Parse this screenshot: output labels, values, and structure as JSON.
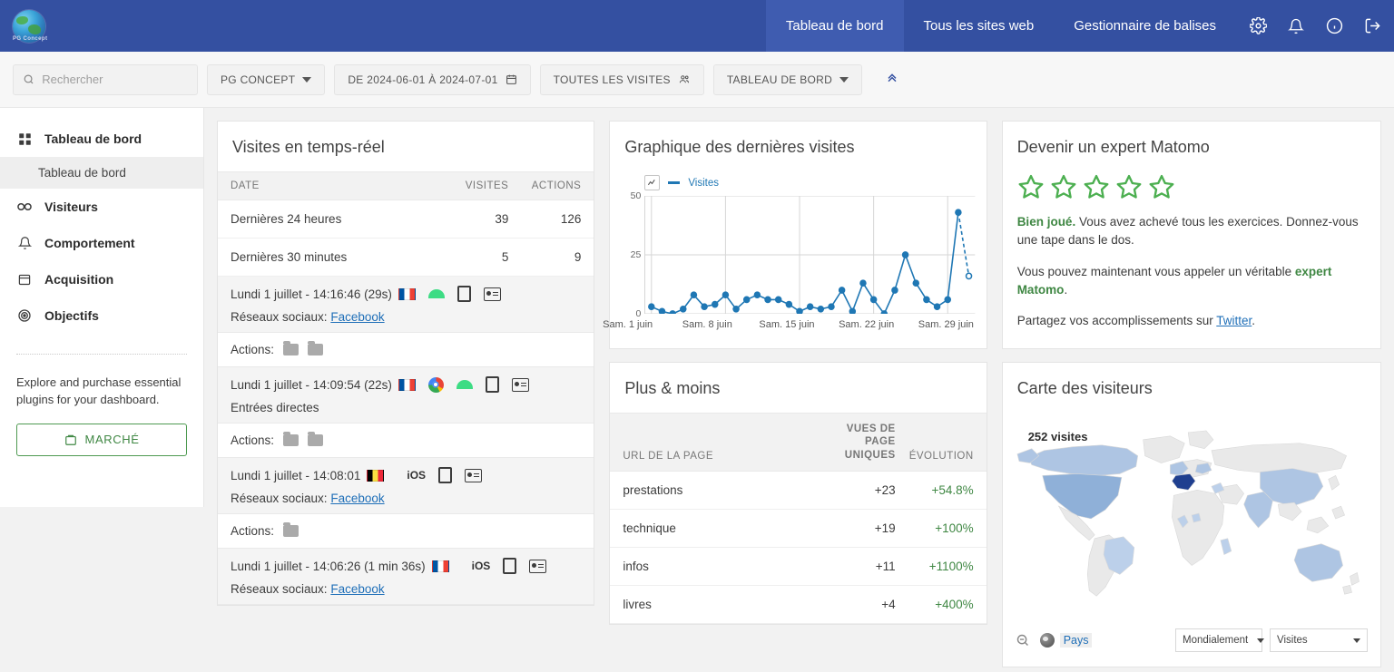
{
  "header": {
    "logo_caption": "PG Concept",
    "nav": [
      {
        "label": "Tableau de bord",
        "active": true
      },
      {
        "label": "Tous les sites web",
        "active": false
      },
      {
        "label": "Gestionnaire de balises",
        "active": false
      }
    ],
    "icons": [
      "gear-icon",
      "bell-icon",
      "info-icon",
      "logout-icon"
    ],
    "brand_color": "#3450a1"
  },
  "filterbar": {
    "search_placeholder": "Rechercher",
    "site_selector": "PG CONCEPT",
    "date_range": "DE 2024-06-01 À 2024-07-01",
    "segment": "TOUTES LES VISITES",
    "dashboard_selector": "TABLEAU DE BORD"
  },
  "sidebar": {
    "items": [
      {
        "label": "Tableau de bord",
        "icon": "grid-icon"
      },
      {
        "label": "Visiteurs",
        "icon": "visitors-icon"
      },
      {
        "label": "Comportement",
        "icon": "bell-icon"
      },
      {
        "label": "Acquisition",
        "icon": "archive-icon"
      },
      {
        "label": "Objectifs",
        "icon": "target-icon"
      }
    ],
    "sub_item": "Tableau de bord",
    "promo_text": "Explore and purchase essential plugins for your dashboard.",
    "market_button": "MARCHÉ"
  },
  "realtime": {
    "title": "Visites en temps-réel",
    "columns": [
      "DATE",
      "VISITES",
      "ACTIONS"
    ],
    "summary": [
      {
        "label": "Dernières 24 heures",
        "visits": "39",
        "actions": "126"
      },
      {
        "label": "Dernières 30 minutes",
        "visits": "5",
        "actions": "9"
      }
    ],
    "actions_label": "Actions:",
    "visits": [
      {
        "time": "Lundi 1 juillet - 14:16:46 (29s)",
        "flag": "fr",
        "browser": null,
        "os": "android",
        "device": "mobile-icon",
        "profile": "visitor-profile-icon",
        "referrer_label": "Réseaux sociaux:",
        "referrer_link": "Facebook",
        "action_count": 2
      },
      {
        "time": "Lundi 1 juillet - 14:09:54 (22s)",
        "flag": "fr",
        "browser": "chrome",
        "os": "android",
        "device": "mobile-icon",
        "profile": "visitor-profile-icon",
        "referrer_label": "Entrées directes",
        "referrer_link": null,
        "action_count": 2
      },
      {
        "time": "Lundi 1 juillet - 14:08:01",
        "flag": "be",
        "browser": null,
        "os": "iOS",
        "device": "mobile-icon",
        "profile": "visitor-profile-icon",
        "referrer_label": "Réseaux sociaux:",
        "referrer_link": "Facebook",
        "action_count": 1
      },
      {
        "time": "Lundi 1 juillet - 14:06:26 (1 min 36s)",
        "flag": "fr",
        "browser": null,
        "os": "iOS",
        "device": "mobile-icon",
        "profile": "visitor-profile-icon",
        "referrer_label": "Réseaux sociaux:",
        "referrer_link": "Facebook",
        "action_count": 0
      }
    ]
  },
  "visits_graph": {
    "title": "Graphique des dernières visites"
  },
  "chart_data": {
    "type": "line",
    "title": "Graphique des dernières visites",
    "xlabel": "",
    "ylabel": "",
    "ylim": [
      0,
      50
    ],
    "yticks": [
      0,
      25,
      50
    ],
    "grid": true,
    "legend": [
      "Visites"
    ],
    "legend_position": "top-left",
    "series_color": "#1f77b4",
    "x_tick_labels": [
      "Sam. 1 juin",
      "Sam. 8 juin",
      "Sam. 15 juin",
      "Sam. 22 juin",
      "Sam. 29 juin"
    ],
    "x_tick_indices": [
      0,
      7,
      14,
      21,
      28
    ],
    "x": [
      "1 juin",
      "2 juin",
      "3 juin",
      "4 juin",
      "5 juin",
      "6 juin",
      "7 juin",
      "8 juin",
      "9 juin",
      "10 juin",
      "11 juin",
      "12 juin",
      "13 juin",
      "14 juin",
      "15 juin",
      "16 juin",
      "17 juin",
      "18 juin",
      "19 juin",
      "20 juin",
      "21 juin",
      "22 juin",
      "23 juin",
      "24 juin",
      "25 juin",
      "26 juin",
      "27 juin",
      "28 juin",
      "29 juin",
      "30 juin",
      "1 juillet"
    ],
    "series": [
      {
        "name": "Visites",
        "values": [
          3,
          1,
          0,
          2,
          8,
          3,
          4,
          8,
          2,
          6,
          8,
          6,
          6,
          4,
          1,
          3,
          2,
          3,
          10,
          1,
          13,
          6,
          0,
          10,
          25,
          13,
          6,
          3,
          6,
          43,
          16
        ]
      }
    ],
    "last_point_dashed": true,
    "last_point_value": 16
  },
  "plus_moins": {
    "title": "Plus & moins",
    "columns": [
      "URL DE LA PAGE",
      "VUES DE PAGE UNIQUES",
      "ÉVOLUTION"
    ],
    "rows": [
      {
        "url": "prestations",
        "views": "+23",
        "evolution": "+54.8%"
      },
      {
        "url": "technique",
        "views": "+19",
        "evolution": "+100%"
      },
      {
        "url": "infos",
        "views": "+11",
        "evolution": "+1100%"
      },
      {
        "url": "livres",
        "views": "+4",
        "evolution": "+400%"
      }
    ],
    "positive_color": "#3f8743"
  },
  "expert": {
    "title": "Devenir un expert Matomo",
    "stars": 5,
    "star_color": "#4caf50",
    "line1_bold": "Bien joué.",
    "line1_rest": " Vous avez achevé tous les exercices. Donnez-vous une tape dans le dos.",
    "line2_pre": "Vous pouvez maintenant vous appeler un véritable ",
    "line2_bold": "expert Matomo",
    "line2_post": ".",
    "line3_pre": "Partagez vos accomplissements sur ",
    "line3_link": "Twitter",
    "line3_post": "."
  },
  "map": {
    "title": "Carte des visiteurs",
    "visits_label": "252 visites",
    "zoom_out_icon": "zoom-out-icon",
    "country_label": "Pays",
    "scope_select": "Mondialement",
    "metric_select": "Visites"
  }
}
